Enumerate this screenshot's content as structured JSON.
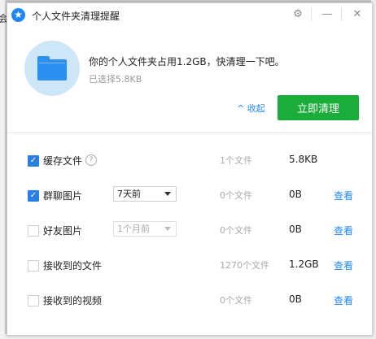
{
  "background": {
    "left_fragment": "会"
  },
  "titlebar": {
    "logo_glyph": "★",
    "title": "个人文件夹清理提醒",
    "settings_glyph": "⚙",
    "minimize_glyph": "—",
    "close_glyph": "✕"
  },
  "header": {
    "headline": "你的个人文件夹占用1.2GB，快清理一下吧。",
    "selected": "已选择5.8KB",
    "collapse_label": "^ 收起",
    "clean_button": "立即清理"
  },
  "rows": [
    {
      "label": "缓存文件",
      "checked": true,
      "help": "?",
      "count": "1个文件",
      "size": "5.8KB",
      "check_glyph": "✓"
    },
    {
      "label": "群聊图片",
      "checked": true,
      "select": "7天前",
      "count": "0个文件",
      "size": "0B",
      "view": "查看",
      "check_glyph": "✓"
    },
    {
      "label": "好友图片",
      "checked": false,
      "select": "1个月前",
      "count": "0个文件",
      "size": "0B",
      "view": "查看"
    },
    {
      "label": "接收到的文件",
      "checked": false,
      "count": "1270个文件",
      "size": "1.2GB",
      "view": "查看"
    },
    {
      "label": "接收到的视频",
      "checked": false,
      "count": "0个文件",
      "size": "0B",
      "view": "查看"
    }
  ],
  "colors": {
    "accent": "#1f87f5",
    "primary_button": "#1aad3a",
    "checkbox": "#2b7fe0"
  }
}
